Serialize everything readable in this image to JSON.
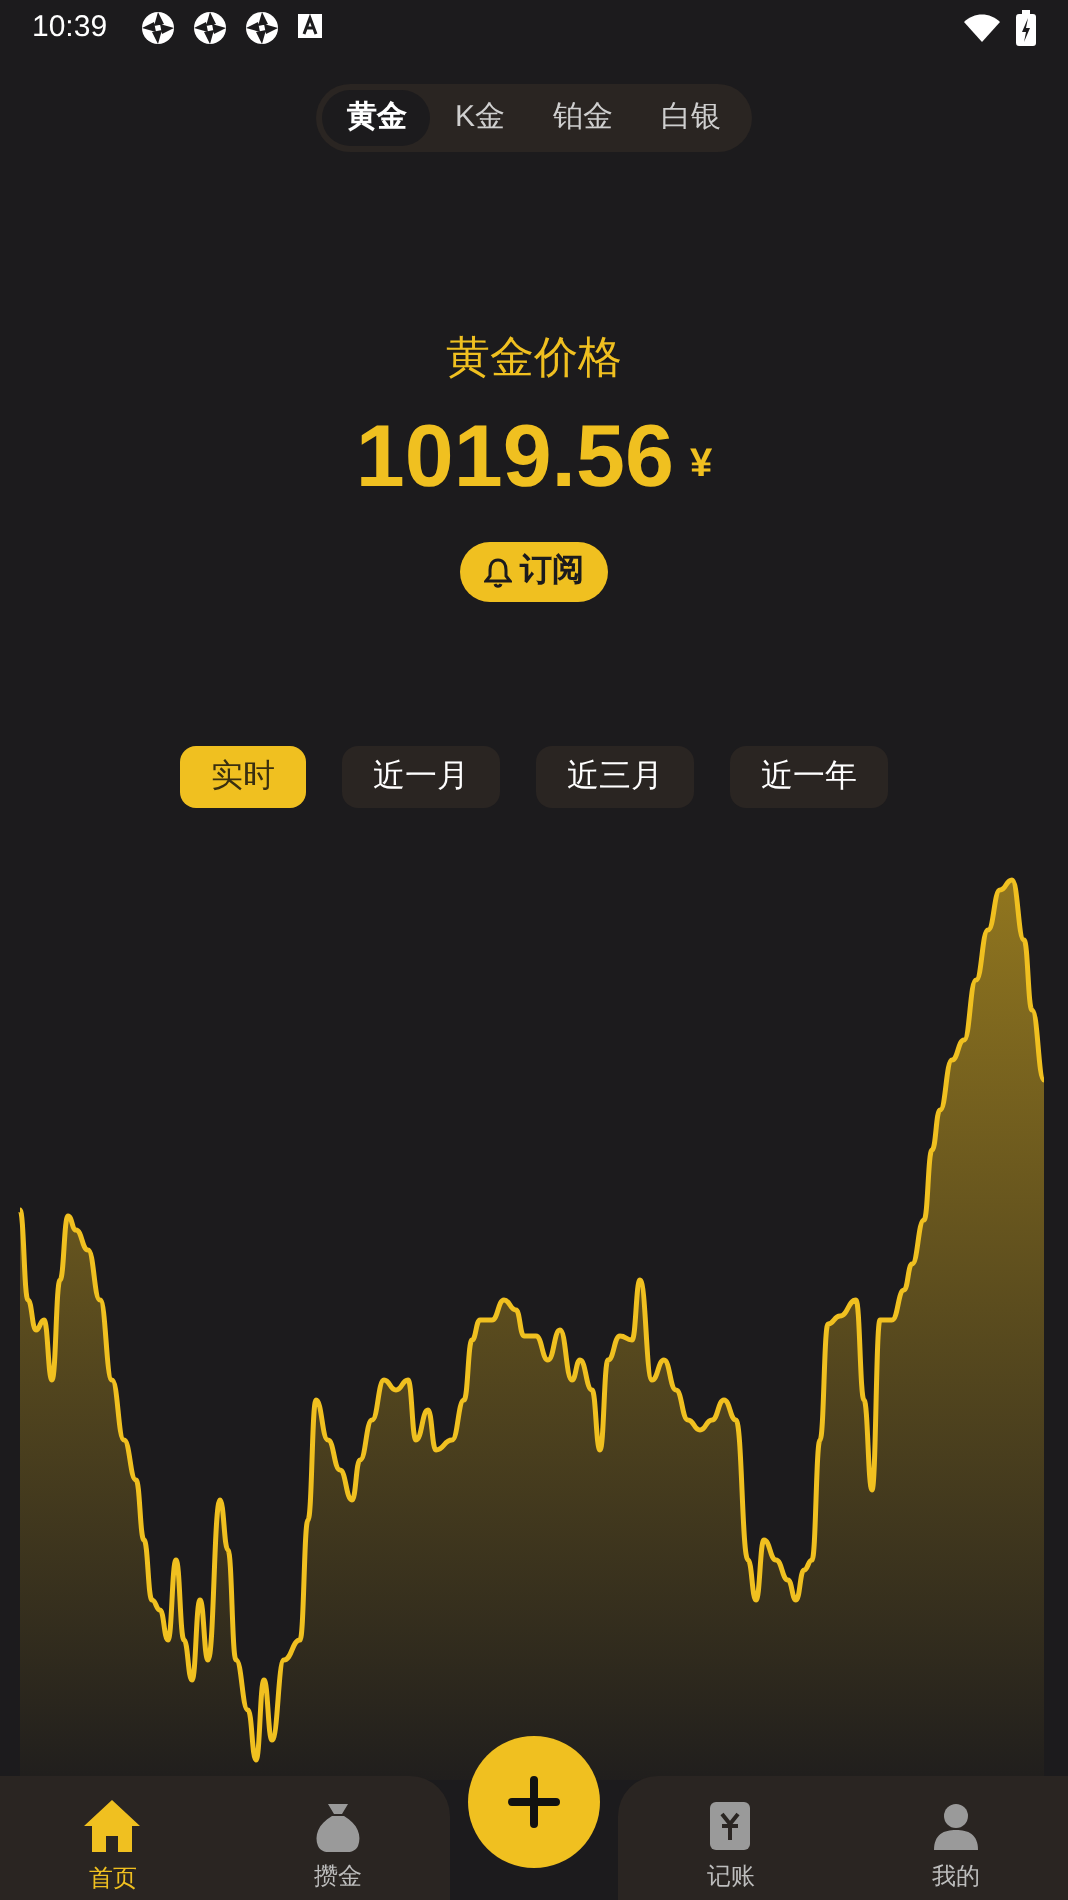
{
  "status_bar": {
    "time": "10:39"
  },
  "metal_tabs": [
    {
      "label": "黄金",
      "selected": true
    },
    {
      "label": "K金",
      "selected": false
    },
    {
      "label": "铂金",
      "selected": false
    },
    {
      "label": "白银",
      "selected": false
    }
  ],
  "price": {
    "title": "黄金价格",
    "value": "1019.56",
    "currency": "¥",
    "subscribe": "订阅"
  },
  "range_tabs": [
    {
      "label": "实时",
      "selected": true
    },
    {
      "label": "近一月",
      "selected": false
    },
    {
      "label": "近三月",
      "selected": false
    },
    {
      "label": "近一年",
      "selected": false
    }
  ],
  "bottom_nav": [
    {
      "label": "首页",
      "selected": true
    },
    {
      "label": "攒金",
      "selected": false
    },
    {
      "label": "记账",
      "selected": false
    },
    {
      "label": "我的",
      "selected": false
    }
  ]
}
